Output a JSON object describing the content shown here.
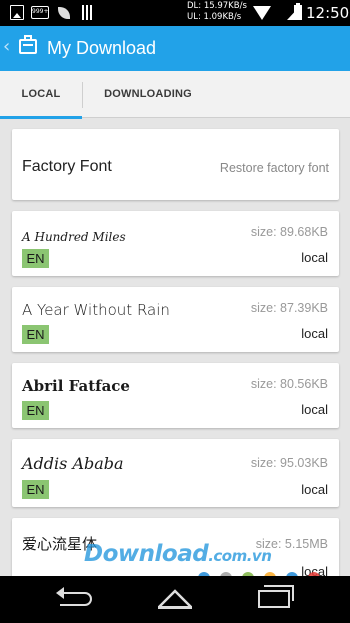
{
  "status_bar": {
    "badge": "999+",
    "speed_down": "DL: 15.97KB/s",
    "speed_up": "UL: 1.09KB/s",
    "time": "12:50"
  },
  "app_bar": {
    "title": "My Download",
    "back_glyph": "‹"
  },
  "tabs": [
    {
      "label": "LOCAL",
      "selected": true
    },
    {
      "label": "DOWNLOADING",
      "selected": false
    }
  ],
  "factory": {
    "name": "Factory Font",
    "action": "Restore factory font"
  },
  "fonts": [
    {
      "name": "A Hundred Miles",
      "size": "size: 89.68KB",
      "lang": "EN",
      "status": "local"
    },
    {
      "name": "A Year Without Rain",
      "size": "size: 87.39KB",
      "lang": "EN",
      "status": "local"
    },
    {
      "name": "Abril Fatface",
      "size": "size: 80.56KB",
      "lang": "EN",
      "status": "local"
    },
    {
      "name": "Addis Ababa",
      "size": "size: 95.03KB",
      "lang": "EN",
      "status": "local"
    },
    {
      "name": "爱心流星体",
      "size": "size: 5.15MB",
      "lang": "",
      "status": "local"
    }
  ],
  "watermark": {
    "text": "Download",
    "suffix": ".com.vn",
    "dot_colors": [
      "#1e88d6",
      "#9e9e9e",
      "#7cb342",
      "#f9a825",
      "#1e88d6",
      "#e53935"
    ]
  },
  "colors": {
    "accent": "#22a2e8",
    "badge": "#8bc572"
  }
}
